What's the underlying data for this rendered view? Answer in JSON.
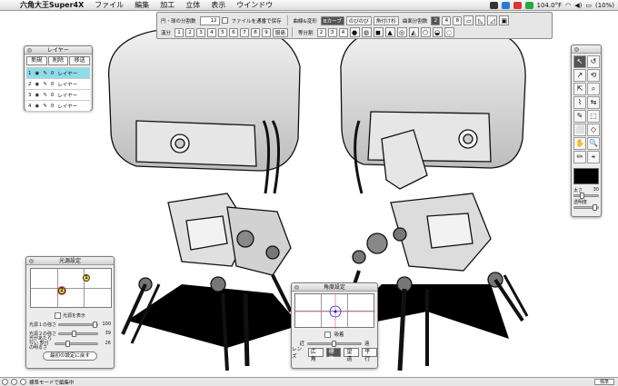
{
  "menubar": {
    "app_name": "六角大王Super4X",
    "menus": [
      "ファイル",
      "編集",
      "加工",
      "立体",
      "表示",
      "ウインドウ"
    ],
    "battery": "(10%)",
    "temperature": "104.0°F"
  },
  "toolbar": {
    "row1": {
      "divisions_label": "円・球の分割数",
      "divisions_value": "12",
      "save_checkbox_label": "ファイルを通番で保存",
      "deform_label": "曲線&変形",
      "mode_on": "Bカーブ",
      "mode_2": "のびのび",
      "mode_3": "角付け杉",
      "face_div_label": "曲面分割数",
      "face_div_values": [
        "2",
        "4",
        "8"
      ]
    },
    "row2": {
      "count_label": "漢分",
      "counts": [
        "1",
        "2",
        "3",
        "4",
        "5",
        "6",
        "7",
        "8",
        "9"
      ],
      "mode_label": "服島",
      "equal_div_label": "等分割",
      "equal_values": [
        "2",
        "3",
        "4"
      ]
    }
  },
  "layer_panel": {
    "title": "レイヤー",
    "buttons": [
      "新規",
      "削除",
      "移送"
    ],
    "rows": [
      {
        "num": "1",
        "count": "0",
        "name": "レイヤー"
      },
      {
        "num": "2",
        "count": "0",
        "name": "レイヤー"
      },
      {
        "num": "3",
        "count": "0",
        "name": "レイヤー"
      },
      {
        "num": "4",
        "count": "0",
        "name": "レイヤー"
      }
    ]
  },
  "light_panel": {
    "title": "光源設定",
    "bulb1": "2",
    "bulb2": "1",
    "show_label": "光源を表示",
    "sliders": [
      {
        "label": "光源１の強さ",
        "value": "100",
        "level": 1.0
      },
      {
        "label": "光源２の強さ",
        "value": "39",
        "level": 0.39
      },
      {
        "label": "光があたらない 部分の明るさ",
        "value": "26",
        "level": 0.26
      }
    ],
    "reset_label": "最初の設定に戻す"
  },
  "angle_panel": {
    "title": "角度設定",
    "snap_label": "吸着",
    "near_label": "近",
    "far_label": "遠",
    "lens_label": "レンズ",
    "lens_options": [
      "広角",
      "標準",
      "望遠",
      "平行"
    ],
    "selected_lens": "標準"
  },
  "tool_panel": {
    "tools": [
      "↖",
      "↺",
      "↗",
      "⟲",
      "⇱",
      "⌕",
      "⌇",
      "⇆",
      "✎",
      "⬚",
      "⬜",
      "◇",
      "✋",
      "🔍",
      "✏",
      "⌖"
    ],
    "opacity_label": "透明度",
    "width_label": "太さ",
    "width_value": "30"
  },
  "status": {
    "message": "標準モードで編集中",
    "right": "標準"
  },
  "colors": {
    "layer_selected": "#8fdce8",
    "bulb1": "#f4d84a",
    "bulb2": "#f4d84a"
  }
}
